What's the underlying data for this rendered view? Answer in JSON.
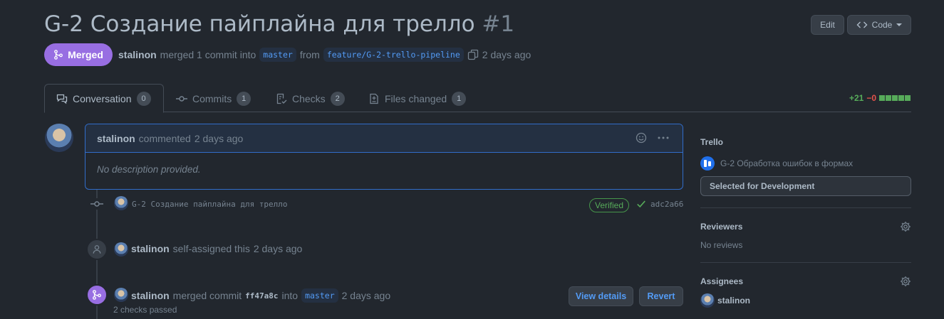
{
  "pr": {
    "title": "G-2 Создание пайплайна для трелло",
    "number": "#1",
    "edit_label": "Edit",
    "code_label": "Code",
    "state": "Merged",
    "author": "stalinon",
    "merge_text": "merged 1 commit into",
    "base_branch": "master",
    "from_text": "from",
    "head_branch": "feature/G-2-trello-pipeline",
    "time": "2 days ago"
  },
  "tabs": [
    {
      "label": "Conversation",
      "count": "0",
      "icon": "comment-discussion-icon"
    },
    {
      "label": "Commits",
      "count": "1",
      "icon": "git-commit-icon"
    },
    {
      "label": "Checks",
      "count": "2",
      "icon": "checklist-icon"
    },
    {
      "label": "Files changed",
      "count": "1",
      "icon": "file-diff-icon"
    }
  ],
  "diffstat": {
    "additions": "+21",
    "deletions": "−0",
    "blocks": 5
  },
  "comment": {
    "author": "stalinon",
    "action": "commented",
    "time": "2 days ago",
    "body": "No description provided."
  },
  "commit": {
    "message": "G-2 Создание пайплайна для трелло",
    "verified": "Verified",
    "sha": "adc2a66"
  },
  "events": {
    "assign": {
      "user": "stalinon",
      "text": "self-assigned this",
      "time": "2 days ago"
    },
    "merge": {
      "user": "stalinon",
      "text": "merged commit",
      "sha": "ff47a8c",
      "into": "into",
      "branch": "master",
      "time": "2 days ago",
      "checks": "2 checks passed",
      "view_details": "View details",
      "revert": "Revert"
    }
  },
  "sidebar": {
    "trello_heading": "Trello",
    "trello_card": "G-2 Обработка ошибок в формах",
    "trello_list": "Selected for Development",
    "reviewers_heading": "Reviewers",
    "reviewers_value": "No reviews",
    "assignees_heading": "Assignees",
    "assignee": "stalinon"
  },
  "colors": {
    "background": "#22272e",
    "merged": "#986ee2",
    "accent": "#539bf5",
    "success": "#57ab5a",
    "danger": "#e5534b"
  }
}
